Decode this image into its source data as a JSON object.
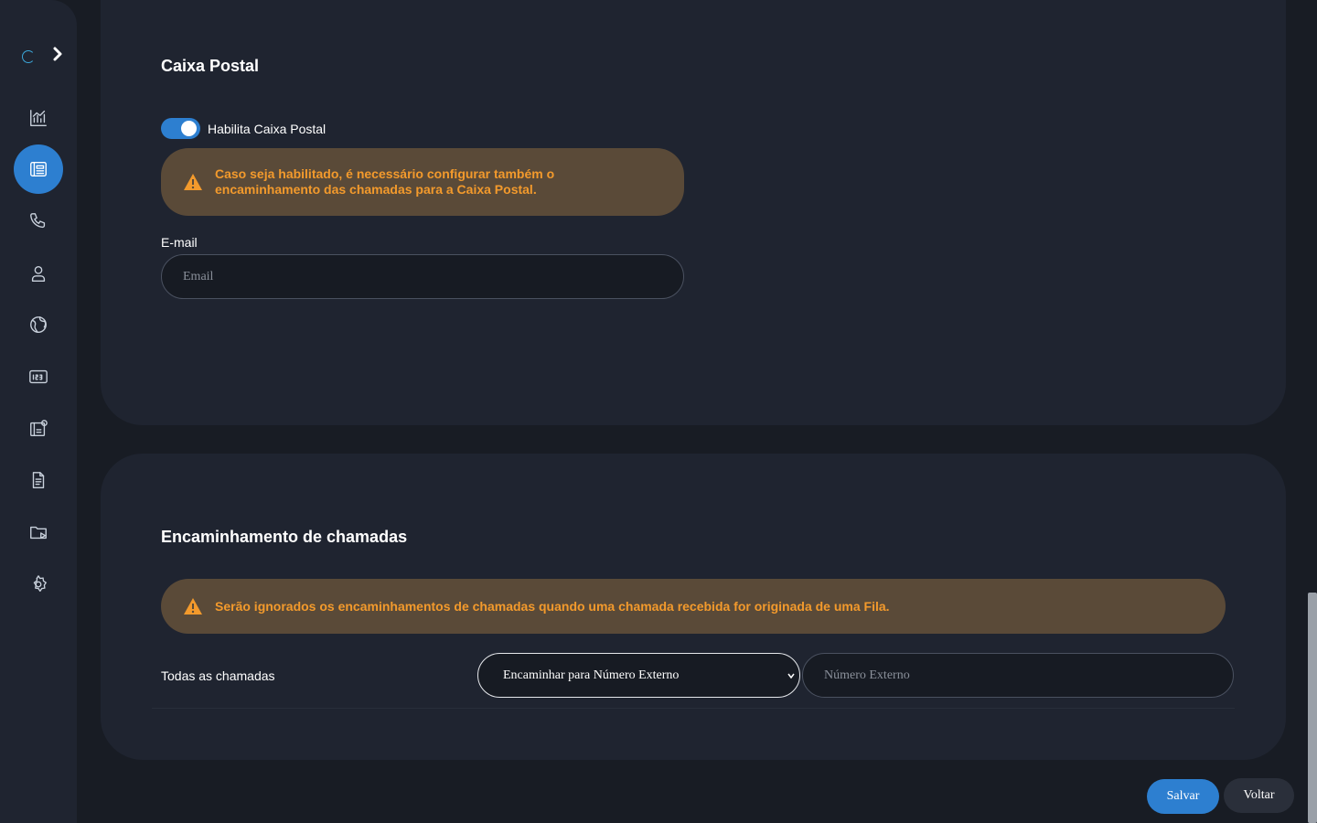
{
  "sidebar": {
    "items": [
      {
        "icon": "chart-icon",
        "active": false
      },
      {
        "icon": "phonebook-icon",
        "active": true
      },
      {
        "icon": "phone-icon",
        "active": false
      },
      {
        "icon": "user-icon",
        "active": false
      },
      {
        "icon": "globe-icon",
        "active": false
      },
      {
        "icon": "numbers-icon",
        "active": false
      },
      {
        "icon": "pbx-settings-icon",
        "active": false
      },
      {
        "icon": "document-icon",
        "active": false
      },
      {
        "icon": "media-folder-icon",
        "active": false
      },
      {
        "icon": "gear-icon",
        "active": false
      }
    ]
  },
  "voicemail": {
    "title": "Caixa Postal",
    "toggle_label": "Habilita Caixa Postal",
    "toggle_on": true,
    "warning_line1": "Caso seja habilitado, é necessário configurar também o",
    "warning_line2": "encaminhamento das chamadas para a Caixa Postal.",
    "email_label": "E-mail",
    "email_placeholder": "Email",
    "email_value": ""
  },
  "forwarding": {
    "title": "Encaminhamento de chamadas",
    "warning": "Serão ignorados os encaminhamentos de chamadas quando uma chamada recebida for originada de uma Fila.",
    "row_label": "Todas as chamadas",
    "select_value": "Encaminhar para Número Externo",
    "external_placeholder": "Número Externo"
  },
  "actions": {
    "save_label": "Salvar",
    "back_label": "Voltar"
  },
  "colors": {
    "accent": "#2d7fd0",
    "warning_text": "#f39a2c",
    "warning_bg": "#5a4a38"
  }
}
